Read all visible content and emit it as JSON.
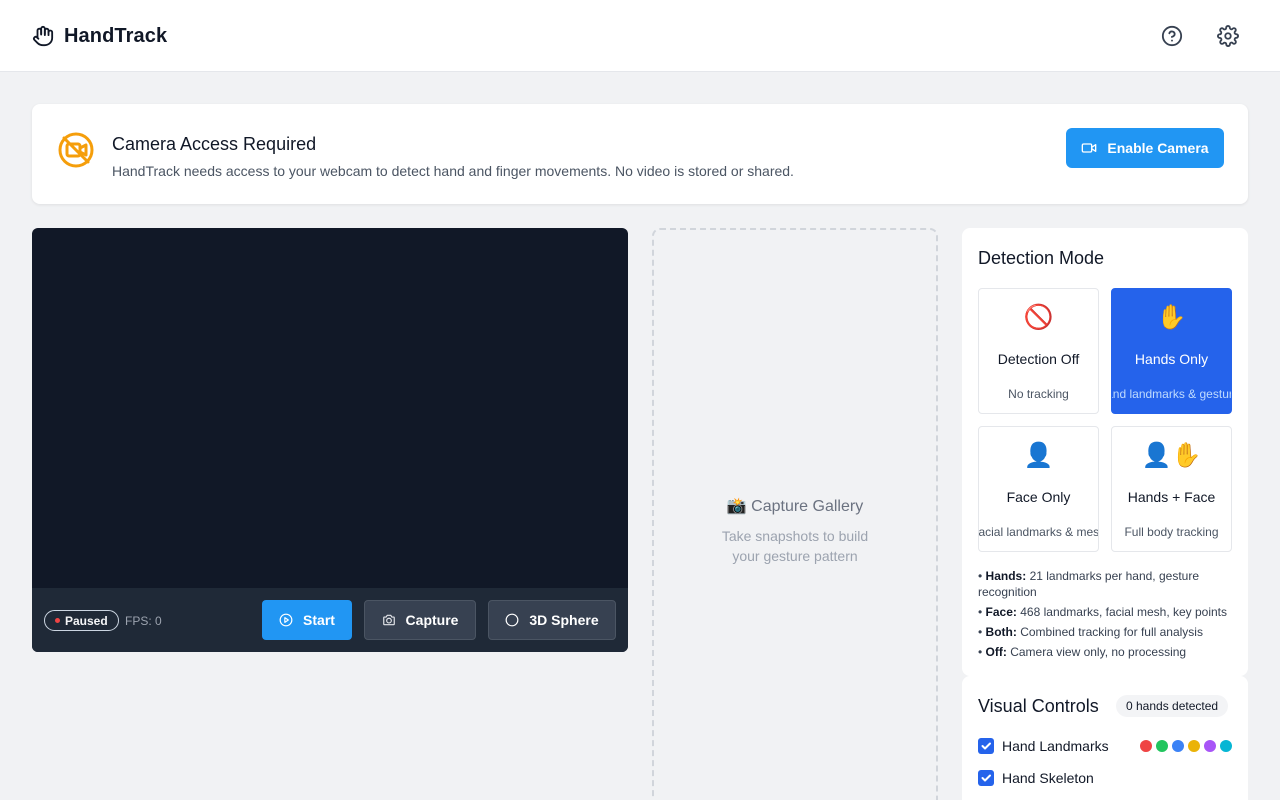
{
  "app": {
    "name": "HandTrack"
  },
  "header": {
    "help_icon": "help-circle-icon",
    "settings_icon": "gear-icon"
  },
  "banner": {
    "title": "Camera Access Required",
    "description": "HandTrack needs access to your webcam to detect hand and finger movements. No video is stored or shared.",
    "button_label": "Enable Camera",
    "icon": "camera-off-icon",
    "accent_color": "#f59e0b"
  },
  "video": {
    "status": "Paused",
    "fps": "FPS: 0",
    "start_label": "Start",
    "capture_label": "Capture",
    "sphere_label": "3D Sphere"
  },
  "gallery": {
    "title": "📸 Capture Gallery",
    "subtitle": "Take snapshots to build your gesture pattern"
  },
  "detection": {
    "title": "Detection Mode",
    "modes": [
      {
        "emoji": "🚫",
        "name": "Detection Off",
        "desc": "No tracking",
        "active": false
      },
      {
        "emoji": "✋",
        "name": "Hands Only",
        "desc": "Hand landmarks & gestures",
        "active": true
      },
      {
        "emoji": "👤",
        "name": "Face Only",
        "desc": "Facial landmarks & mesh",
        "active": false
      },
      {
        "emoji": "👤✋",
        "name": "Hands + Face",
        "desc": "Full body tracking",
        "active": false
      }
    ],
    "notes": [
      {
        "label": "Hands:",
        "text": "21 landmarks per hand, gesture recognition"
      },
      {
        "label": "Face:",
        "text": "468 landmarks, facial mesh, key points"
      },
      {
        "label": "Both:",
        "text": "Combined tracking for full analysis"
      },
      {
        "label": "Off:",
        "text": "Camera view only, no processing"
      }
    ]
  },
  "visual_controls": {
    "title": "Visual Controls",
    "badge": "0 hands detected",
    "options": [
      {
        "label": "Hand Landmarks",
        "checked": true
      },
      {
        "label": "Hand Skeleton",
        "checked": true
      }
    ],
    "landmark_colors": [
      "#ef4444",
      "#22c55e",
      "#3b82f6",
      "#eab308",
      "#a855f7",
      "#06b6d4"
    ]
  },
  "colors": {
    "primary": "#2196f3",
    "active_mode": "#2563eb",
    "video_bg": "#111827"
  }
}
